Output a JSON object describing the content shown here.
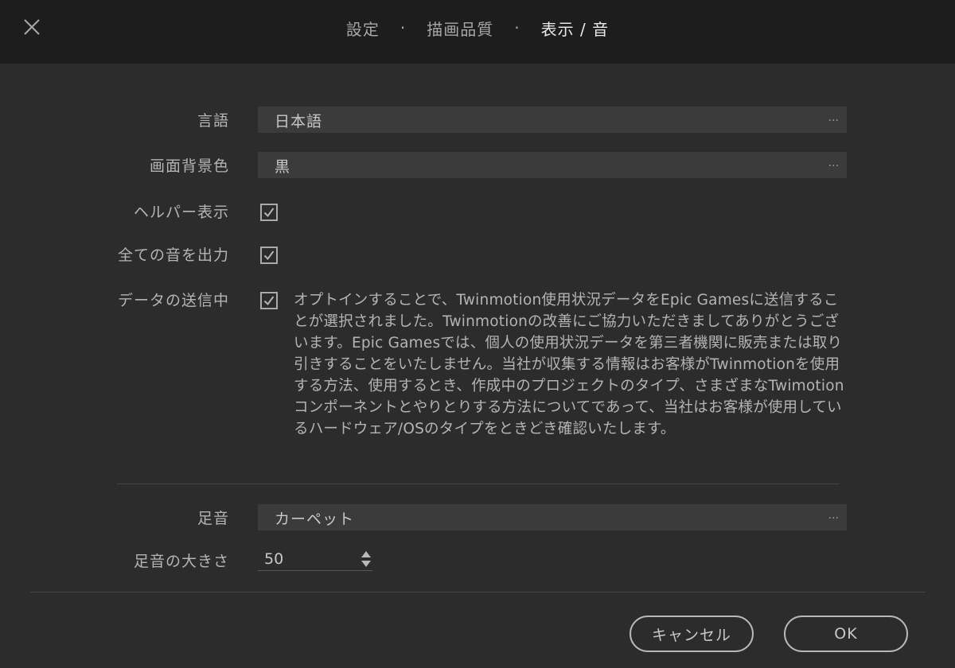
{
  "header": {
    "close_icon": "close-icon",
    "crumbs": [
      "設定",
      "描画品質",
      "表示 / 音"
    ],
    "separator": "·"
  },
  "settings": {
    "language": {
      "label": "言語",
      "value": "日本語",
      "more": "..."
    },
    "background_color": {
      "label": "画面背景色",
      "value": "黒",
      "more": "..."
    },
    "helper_display": {
      "label": "ヘルパー表示",
      "checked": true
    },
    "output_all_sounds": {
      "label": "全ての音を出力",
      "checked": true
    },
    "data_sending": {
      "label": "データの送信中",
      "checked": true,
      "description": "オプトインすることで、Twinmotion使用状況データをEpic Gamesに送信することが選択されました。Twinmotionの改善にご協力いただきましてありがとうございます。Epic Gamesでは、個人の使用状況データを第三者機関に販売または取り引きすることをいたしません。当社が収集する情報はお客様がTwinmotionを使用する方法、使用するとき、作成中のプロジェクトのタイプ、さまざまなTwimotionコンポーネントとやりとりする方法についてであって、当社はお客様が使用しているハードウェア/OSのタイプをときどき確認いたします。"
    },
    "footsteps": {
      "label": "足音",
      "value": "カーペット",
      "more": "..."
    },
    "footstep_volume": {
      "label": "足音の大きさ",
      "value": "50"
    }
  },
  "footer": {
    "cancel_label": "キャンセル",
    "ok_label": "OK"
  }
}
